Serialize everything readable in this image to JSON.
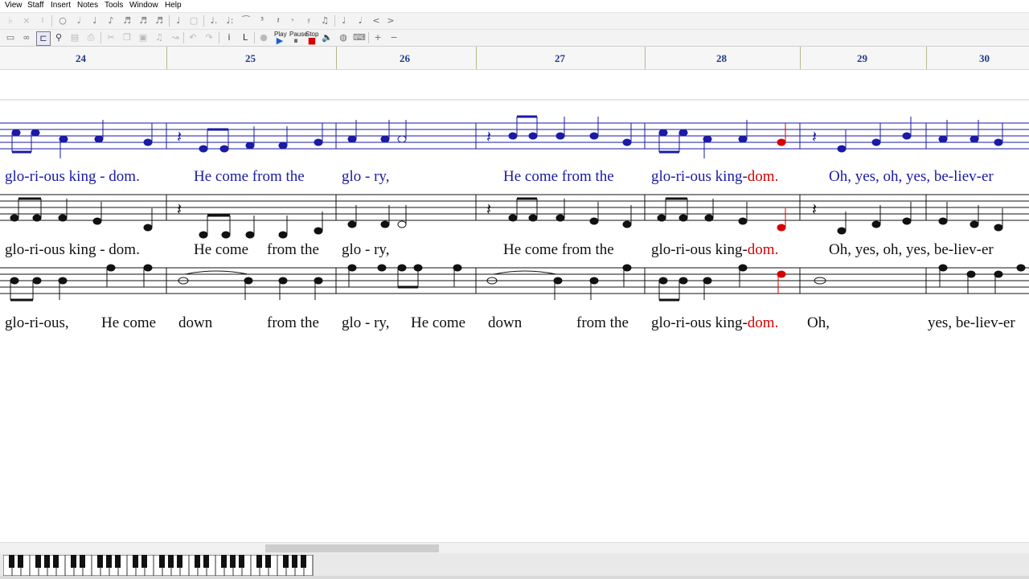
{
  "menu": [
    "View",
    "Staff",
    "Insert",
    "Notes",
    "Tools",
    "Window",
    "Help"
  ],
  "toolbar": {
    "play_label": "Play",
    "pause_label": "Pause",
    "stop_label": "Stop"
  },
  "ruler": {
    "measures": [
      "24",
      "25",
      "26",
      "27",
      "28",
      "29",
      "30"
    ]
  },
  "lyrics": {
    "line1": {
      "pre": "glo-ri-ous king - dom.",
      "a": "He come from the",
      "b": "glo - ry,",
      "c": "He come from the",
      "d": "glo-ri-ous king-",
      "d_red": "dom.",
      "e": "Oh, yes, oh, yes, be-liev-er"
    },
    "line2": {
      "pre": "glo-ri-ous king - dom.",
      "a": "He come",
      "a2": "from the",
      "b": "glo - ry,",
      "c": "He come from the",
      "d": "glo-ri-ous king-",
      "d_red": "dom.",
      "e": "Oh, yes, oh, yes, be-liev-er"
    },
    "line3": {
      "pre": "glo-ri-ous,",
      "a": "He come",
      "a2": "down",
      "b": "from the",
      "c": "glo - ry,",
      "d": "He come",
      "d2": "down",
      "e": "from the",
      "f": "glo-ri-ous king-",
      "f_red": "dom.",
      "g": "Oh,",
      "h": "yes, be-liev-er"
    }
  },
  "colors": {
    "blue_staff": "#1a1aa6",
    "black_staff": "#111111",
    "highlight": "#d40000",
    "ruler_text": "#1f3a8a"
  }
}
